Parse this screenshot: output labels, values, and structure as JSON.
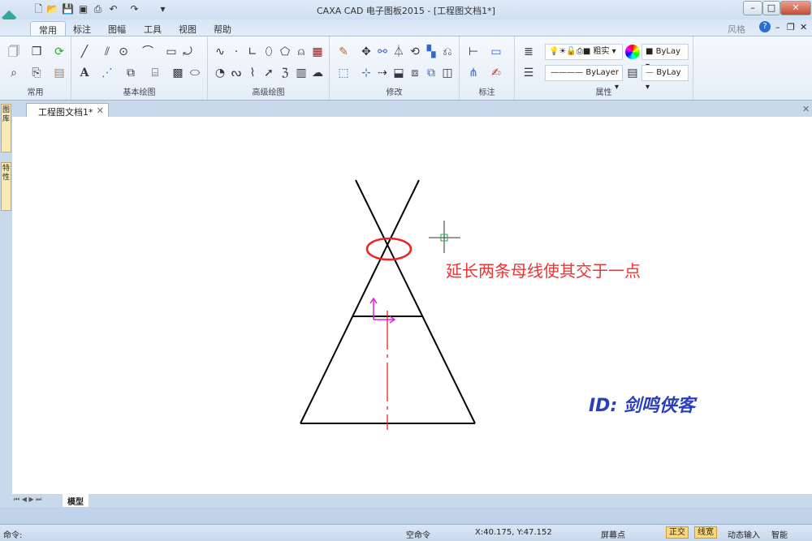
{
  "window": {
    "title": "CAXA CAD 电子图板2015 - [工程图文档1*]",
    "style_label": "风格"
  },
  "ribbon_tabs": [
    "常用",
    "标注",
    "图幅",
    "工具",
    "视图",
    "帮助"
  ],
  "groups": [
    "常用",
    "基本绘图",
    "高级绘图",
    "修改",
    "标注",
    "属性"
  ],
  "properties": {
    "layer": "粗实",
    "color": "ByLay",
    "linetype": "ByLayer",
    "lineweight": "ByLay"
  },
  "document_tab": "工程图文档1*",
  "side_tabs": [
    "图库",
    "特性"
  ],
  "layout_tab": "模型",
  "drawing": {
    "annotation": "延长两条母线使其交于一点",
    "watermark": "ID: 剑鸣侠客"
  },
  "status": {
    "command_label": "命令:",
    "command_state": "空命令",
    "coordinates": "X:40.175, Y:47.152",
    "snap": "屏幕点",
    "toggles": [
      "正交",
      "线宽",
      "动态输入",
      "智能"
    ]
  },
  "colors": {
    "annotation": "#ee3333",
    "watermark": "#2a3fbf",
    "ucs": "#e020e0"
  }
}
